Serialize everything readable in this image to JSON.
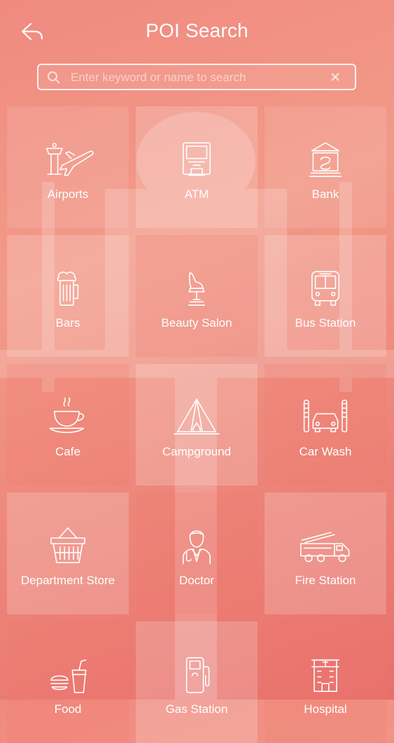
{
  "header": {
    "title": "POI Search"
  },
  "search": {
    "placeholder": "Enter keyword or name to search",
    "value": ""
  },
  "categories": [
    {
      "label": "Airports",
      "icon": "airport-icon"
    },
    {
      "label": "ATM",
      "icon": "atm-icon"
    },
    {
      "label": "Bank",
      "icon": "bank-icon"
    },
    {
      "label": "Bars",
      "icon": "beer-icon"
    },
    {
      "label": "Beauty Salon",
      "icon": "salon-chair-icon"
    },
    {
      "label": "Bus Station",
      "icon": "bus-icon"
    },
    {
      "label": "Cafe",
      "icon": "coffee-cup-icon"
    },
    {
      "label": "Campground",
      "icon": "tent-icon"
    },
    {
      "label": "Car Wash",
      "icon": "car-wash-icon"
    },
    {
      "label": "Department Store",
      "icon": "basket-icon"
    },
    {
      "label": "Doctor",
      "icon": "doctor-icon"
    },
    {
      "label": "Fire Station",
      "icon": "fire-truck-icon"
    },
    {
      "label": "Food",
      "icon": "burger-drink-icon"
    },
    {
      "label": "Gas Station",
      "icon": "fuel-pump-icon"
    },
    {
      "label": "Hospital",
      "icon": "hospital-icon"
    }
  ]
}
